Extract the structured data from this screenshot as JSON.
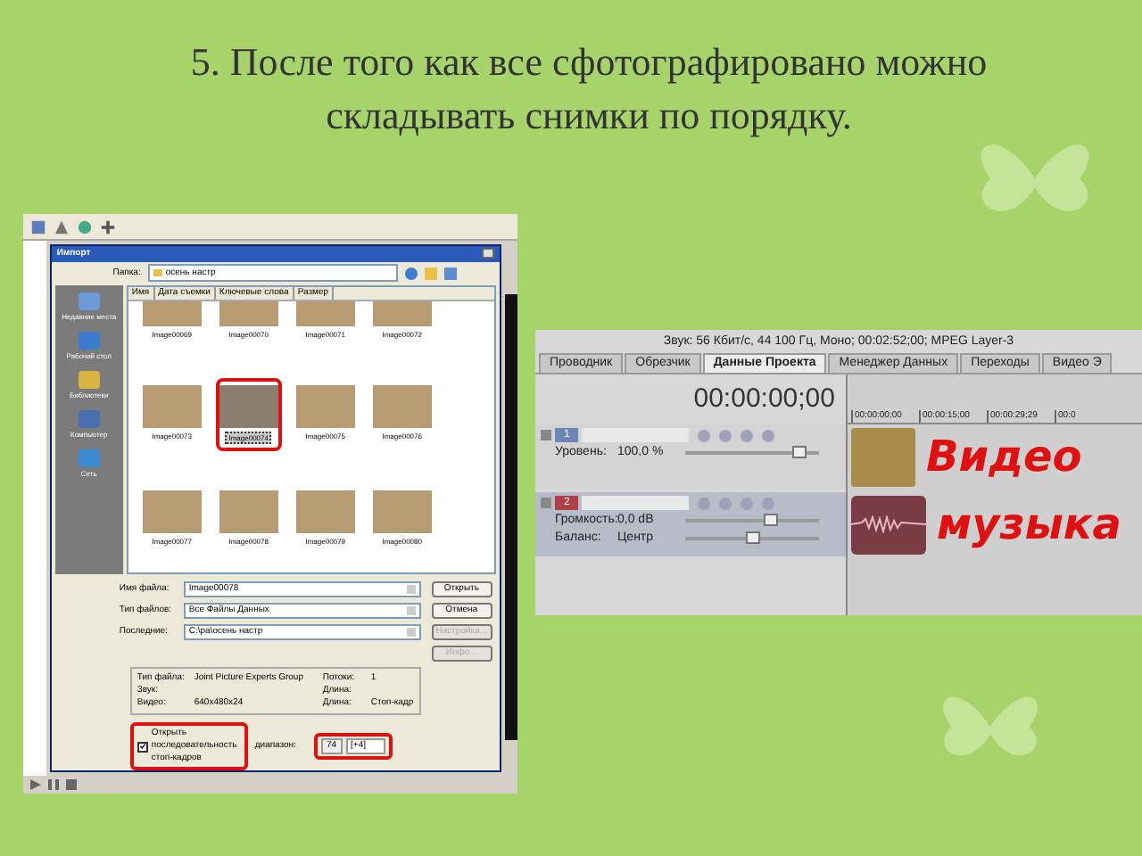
{
  "heading": "5. После того как все сфотографировано можно складывать снимки по порядку.",
  "import_dialog": {
    "title": "Импорт",
    "folder_label": "Папка:",
    "folder": "осень настр",
    "columns": [
      "Имя",
      "Дата съемки",
      "Ключевые слова",
      "Размер"
    ],
    "places": [
      {
        "label": "Недавние места"
      },
      {
        "label": "Рабочий стол"
      },
      {
        "label": "Библиотеки"
      },
      {
        "label": "Компьютер"
      },
      {
        "label": "Сеть"
      }
    ],
    "thumbnail_rows": [
      [
        {
          "label": "Image00069",
          "selected": false,
          "circled": false
        },
        {
          "label": "Image00070",
          "selected": false,
          "circled": false
        },
        {
          "label": "Image00071",
          "selected": false,
          "circled": false
        },
        {
          "label": "Image00072",
          "selected": false,
          "circled": false
        }
      ],
      [
        {
          "label": "Image00073",
          "selected": false,
          "circled": false
        },
        {
          "label": "Image00074",
          "selected": true,
          "circled": true
        },
        {
          "label": "Image00075",
          "selected": false,
          "circled": false
        },
        {
          "label": "Image00076",
          "selected": false,
          "circled": false
        }
      ],
      [
        {
          "label": "Image00077",
          "selected": false,
          "circled": false
        },
        {
          "label": "Image00078",
          "selected": false,
          "circled": false
        },
        {
          "label": "Image00079",
          "selected": false,
          "circled": false
        },
        {
          "label": "Image00080",
          "selected": false,
          "circled": false
        }
      ]
    ],
    "fields": [
      {
        "label": "Имя файла:",
        "value": "Image00078"
      },
      {
        "label": "Тип файлов:",
        "value": "Все Файлы Данных"
      },
      {
        "label": "Последние:",
        "value": "C:\\pa\\осень настр"
      }
    ],
    "buttons": [
      {
        "label": "Открыть",
        "disabled": false
      },
      {
        "label": "Отмена",
        "disabled": false
      },
      {
        "label": "Настройка...",
        "disabled": true
      },
      {
        "label": "Инфо...",
        "disabled": true
      }
    ],
    "info": [
      {
        "label": "Тип файла:",
        "value": "Joint Picture Experts Group"
      },
      {
        "label": "Потоки:",
        "value": "1"
      },
      {
        "label": "Звук:"
      },
      {
        "label": "Длина:"
      },
      {
        "label": "Видео:",
        "value": "640x480x24"
      },
      {
        "label": "Длина:",
        "value": "Стоп-кадр"
      }
    ],
    "sequence_checkbox": {
      "label": "Открыть последовательность стоп-кадров",
      "checked": true,
      "circled": true
    },
    "range": {
      "label": "диапазон:",
      "from": "74",
      "to": "[+4]",
      "circled": true
    }
  },
  "editor": {
    "info_line": "Звук: 56 Кбит/с, 44 100 Гц, Моно; 00:02:52;00; MPEG Layer-3",
    "tabs": [
      {
        "label": "Проводник",
        "selected": false
      },
      {
        "label": "Обрезчик",
        "selected": false
      },
      {
        "label": "Данные Проекта",
        "selected": true
      },
      {
        "label": "Менеджер Данных",
        "selected": false
      },
      {
        "label": "Переходы",
        "selected": false
      },
      {
        "label": "Видео Э",
        "selected": false
      }
    ],
    "timecode": "00:00:00;00",
    "ruler": [
      "00:00:00;00",
      "00:00:15;00",
      "00:00:29;29",
      "00:0"
    ],
    "tracks": [
      {
        "kind": "video",
        "number": "1",
        "controls": [
          {
            "label": "Уровень:",
            "value": "100,0 %",
            "level": 0.9
          }
        ],
        "note": "Видео"
      },
      {
        "kind": "audio",
        "number": "2",
        "controls": [
          {
            "label": "Громкость:",
            "value": "0,0 dB",
            "level": 0.65
          },
          {
            "label": "Баланс:",
            "value": "Центр",
            "level": 0.5
          }
        ],
        "note": "музыка"
      }
    ]
  }
}
